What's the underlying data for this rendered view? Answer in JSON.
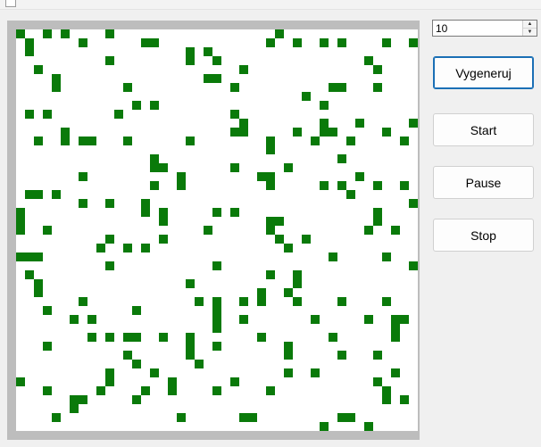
{
  "controls": {
    "size_value": "10",
    "spin_up_glyph": "▲",
    "spin_down_glyph": "▼",
    "generate_label": "Vygeneruj",
    "start_label": "Start",
    "pause_label": "Pause",
    "stop_label": "Stop"
  },
  "colors": {
    "live_cell": "#0a7a0a",
    "board_bg": "#ffffff",
    "board_frame": "#bdbdbd",
    "focus_border": "#1a6fb5"
  },
  "grid": {
    "columns": 45,
    "rows": 45,
    "live_cells": [
      [
        0,
        0
      ],
      [
        3,
        0
      ],
      [
        5,
        0
      ],
      [
        10,
        0
      ],
      [
        29,
        0
      ],
      [
        1,
        1
      ],
      [
        7,
        1
      ],
      [
        14,
        1
      ],
      [
        15,
        1
      ],
      [
        28,
        1
      ],
      [
        31,
        1
      ],
      [
        34,
        1
      ],
      [
        36,
        1
      ],
      [
        41,
        1
      ],
      [
        44,
        1
      ],
      [
        1,
        2
      ],
      [
        19,
        2
      ],
      [
        21,
        2
      ],
      [
        10,
        3
      ],
      [
        19,
        3
      ],
      [
        22,
        3
      ],
      [
        39,
        3
      ],
      [
        2,
        4
      ],
      [
        25,
        4
      ],
      [
        40,
        4
      ],
      [
        4,
        5
      ],
      [
        21,
        5
      ],
      [
        22,
        5
      ],
      [
        4,
        6
      ],
      [
        12,
        6
      ],
      [
        24,
        6
      ],
      [
        35,
        6
      ],
      [
        36,
        6
      ],
      [
        40,
        6
      ],
      [
        32,
        7
      ],
      [
        13,
        8
      ],
      [
        15,
        8
      ],
      [
        34,
        8
      ],
      [
        1,
        9
      ],
      [
        3,
        9
      ],
      [
        11,
        9
      ],
      [
        24,
        9
      ],
      [
        25,
        10
      ],
      [
        34,
        10
      ],
      [
        38,
        10
      ],
      [
        44,
        10
      ],
      [
        5,
        11
      ],
      [
        24,
        11
      ],
      [
        25,
        11
      ],
      [
        31,
        11
      ],
      [
        34,
        11
      ],
      [
        35,
        11
      ],
      [
        41,
        11
      ],
      [
        2,
        12
      ],
      [
        5,
        12
      ],
      [
        7,
        12
      ],
      [
        8,
        12
      ],
      [
        12,
        12
      ],
      [
        19,
        12
      ],
      [
        28,
        12
      ],
      [
        33,
        12
      ],
      [
        37,
        12
      ],
      [
        43,
        12
      ],
      [
        28,
        13
      ],
      [
        15,
        14
      ],
      [
        36,
        14
      ],
      [
        15,
        15
      ],
      [
        16,
        15
      ],
      [
        24,
        15
      ],
      [
        30,
        15
      ],
      [
        7,
        16
      ],
      [
        18,
        16
      ],
      [
        27,
        16
      ],
      [
        28,
        16
      ],
      [
        38,
        16
      ],
      [
        15,
        17
      ],
      [
        18,
        17
      ],
      [
        28,
        17
      ],
      [
        34,
        17
      ],
      [
        36,
        17
      ],
      [
        40,
        17
      ],
      [
        43,
        17
      ],
      [
        1,
        18
      ],
      [
        2,
        18
      ],
      [
        4,
        18
      ],
      [
        37,
        18
      ],
      [
        7,
        19
      ],
      [
        10,
        19
      ],
      [
        14,
        19
      ],
      [
        44,
        19
      ],
      [
        0,
        20
      ],
      [
        14,
        20
      ],
      [
        16,
        20
      ],
      [
        22,
        20
      ],
      [
        24,
        20
      ],
      [
        40,
        20
      ],
      [
        0,
        21
      ],
      [
        16,
        21
      ],
      [
        28,
        21
      ],
      [
        29,
        21
      ],
      [
        40,
        21
      ],
      [
        0,
        22
      ],
      [
        3,
        22
      ],
      [
        21,
        22
      ],
      [
        28,
        22
      ],
      [
        39,
        22
      ],
      [
        42,
        22
      ],
      [
        10,
        23
      ],
      [
        16,
        23
      ],
      [
        29,
        23
      ],
      [
        32,
        23
      ],
      [
        9,
        24
      ],
      [
        12,
        24
      ],
      [
        14,
        24
      ],
      [
        30,
        24
      ],
      [
        0,
        25
      ],
      [
        1,
        25
      ],
      [
        2,
        25
      ],
      [
        35,
        25
      ],
      [
        41,
        25
      ],
      [
        10,
        26
      ],
      [
        22,
        26
      ],
      [
        44,
        26
      ],
      [
        1,
        27
      ],
      [
        28,
        27
      ],
      [
        31,
        27
      ],
      [
        2,
        28
      ],
      [
        19,
        28
      ],
      [
        31,
        28
      ],
      [
        2,
        29
      ],
      [
        27,
        29
      ],
      [
        30,
        29
      ],
      [
        7,
        30
      ],
      [
        20,
        30
      ],
      [
        22,
        30
      ],
      [
        25,
        30
      ],
      [
        27,
        30
      ],
      [
        31,
        30
      ],
      [
        36,
        30
      ],
      [
        41,
        30
      ],
      [
        3,
        31
      ],
      [
        13,
        31
      ],
      [
        22,
        31
      ],
      [
        6,
        32
      ],
      [
        8,
        32
      ],
      [
        22,
        32
      ],
      [
        25,
        32
      ],
      [
        33,
        32
      ],
      [
        39,
        32
      ],
      [
        42,
        32
      ],
      [
        43,
        32
      ],
      [
        22,
        33
      ],
      [
        42,
        33
      ],
      [
        8,
        34
      ],
      [
        10,
        34
      ],
      [
        12,
        34
      ],
      [
        13,
        34
      ],
      [
        16,
        34
      ],
      [
        19,
        34
      ],
      [
        27,
        34
      ],
      [
        35,
        34
      ],
      [
        42,
        34
      ],
      [
        3,
        35
      ],
      [
        19,
        35
      ],
      [
        22,
        35
      ],
      [
        30,
        35
      ],
      [
        12,
        36
      ],
      [
        19,
        36
      ],
      [
        30,
        36
      ],
      [
        36,
        36
      ],
      [
        40,
        36
      ],
      [
        13,
        37
      ],
      [
        20,
        37
      ],
      [
        10,
        38
      ],
      [
        15,
        38
      ],
      [
        30,
        38
      ],
      [
        33,
        38
      ],
      [
        42,
        38
      ],
      [
        0,
        39
      ],
      [
        10,
        39
      ],
      [
        17,
        39
      ],
      [
        24,
        39
      ],
      [
        40,
        39
      ],
      [
        3,
        40
      ],
      [
        9,
        40
      ],
      [
        14,
        40
      ],
      [
        17,
        40
      ],
      [
        22,
        40
      ],
      [
        28,
        40
      ],
      [
        41,
        40
      ],
      [
        6,
        41
      ],
      [
        7,
        41
      ],
      [
        13,
        41
      ],
      [
        41,
        41
      ],
      [
        43,
        41
      ],
      [
        6,
        42
      ],
      [
        4,
        43
      ],
      [
        18,
        43
      ],
      [
        25,
        43
      ],
      [
        26,
        43
      ],
      [
        36,
        43
      ],
      [
        37,
        43
      ],
      [
        34,
        44
      ],
      [
        39,
        44
      ]
    ]
  }
}
